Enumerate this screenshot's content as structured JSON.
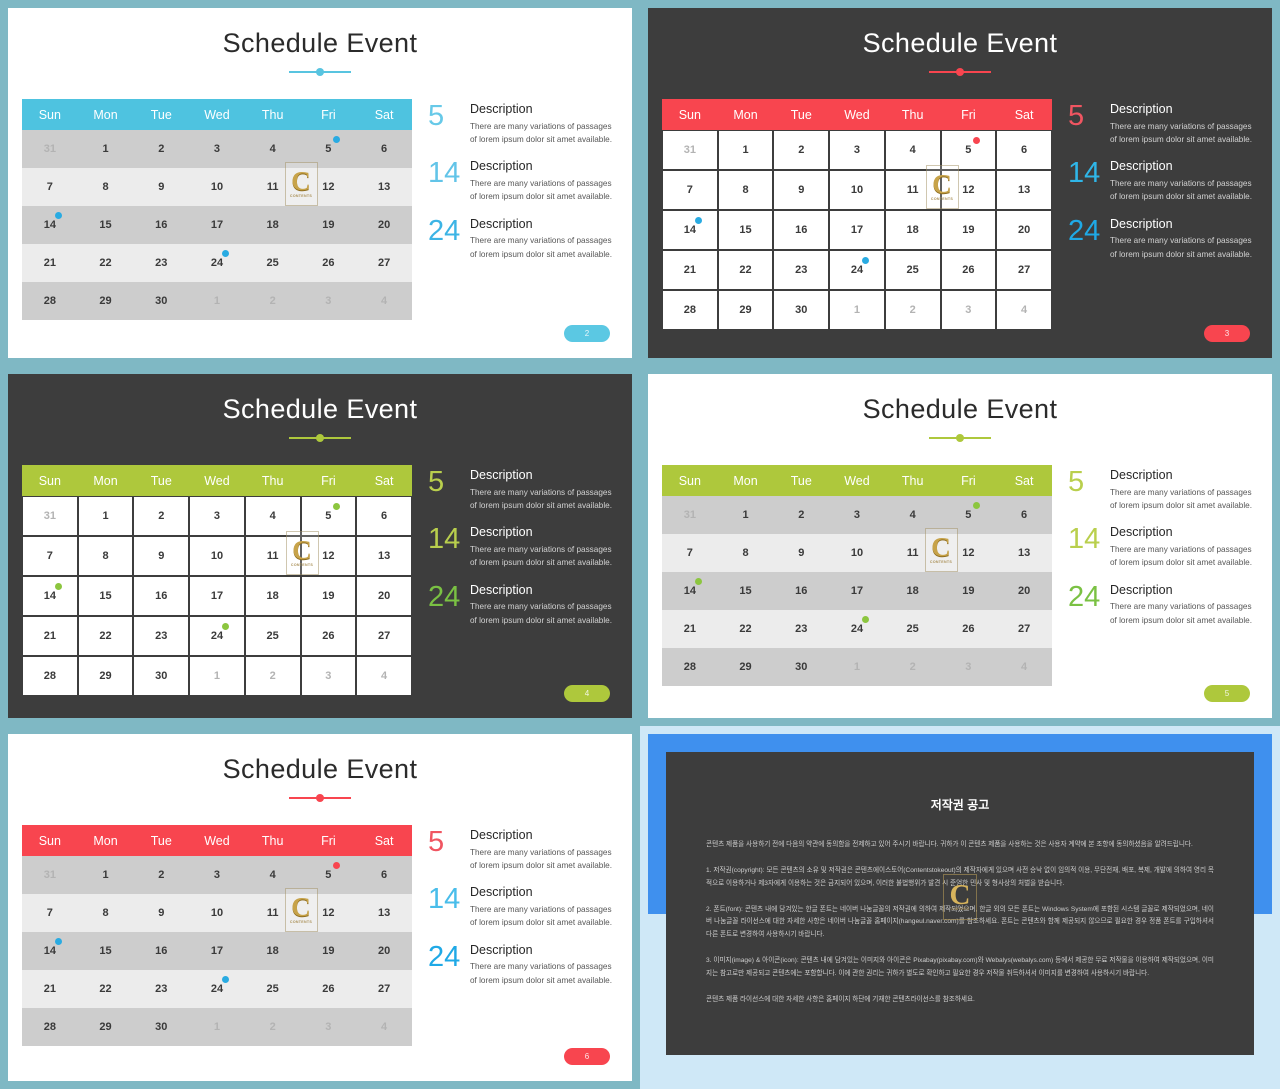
{
  "deck": {
    "frame_color": "#7fb8c4",
    "slide_title": "Schedule Event",
    "weekdays": [
      "Sun",
      "Mon",
      "Tue",
      "Wed",
      "Thu",
      "Fri",
      "Sat"
    ],
    "calendar_rows": [
      [
        {
          "d": "31",
          "muted": true
        },
        {
          "d": "1"
        },
        {
          "d": "2"
        },
        {
          "d": "3"
        },
        {
          "d": "4"
        },
        {
          "d": "5",
          "marker": true
        },
        {
          "d": "6"
        }
      ],
      [
        {
          "d": "7"
        },
        {
          "d": "8"
        },
        {
          "d": "9"
        },
        {
          "d": "10"
        },
        {
          "d": "11"
        },
        {
          "d": "12"
        },
        {
          "d": "13"
        }
      ],
      [
        {
          "d": "14",
          "marker": true
        },
        {
          "d": "15"
        },
        {
          "d": "16"
        },
        {
          "d": "17"
        },
        {
          "d": "18"
        },
        {
          "d": "19"
        },
        {
          "d": "20"
        }
      ],
      [
        {
          "d": "21"
        },
        {
          "d": "22"
        },
        {
          "d": "23"
        },
        {
          "d": "24",
          "marker": true
        },
        {
          "d": "25"
        },
        {
          "d": "26"
        },
        {
          "d": "27"
        }
      ],
      [
        {
          "d": "28"
        },
        {
          "d": "29"
        },
        {
          "d": "30"
        },
        {
          "d": "1",
          "muted": true
        },
        {
          "d": "2",
          "muted": true
        },
        {
          "d": "3",
          "muted": true
        },
        {
          "d": "4",
          "muted": true
        }
      ]
    ],
    "descriptions": [
      {
        "number": "5",
        "heading": "Description",
        "body": "There are many variations of passages of lorem ipsum dolor sit amet available."
      },
      {
        "number": "14",
        "heading": "Description",
        "body": "There are many variations of passages of lorem ipsum dolor sit amet available."
      },
      {
        "number": "24",
        "heading": "Description",
        "body": "There are many variations of passages of lorem ipsum dolor sit amet available."
      }
    ],
    "watermark": {
      "letter": "C",
      "sub": "CONTENTS"
    }
  },
  "slides": [
    {
      "id": "slide-2",
      "theme": "light",
      "page_number": "2",
      "accent": "#4ec3e0",
      "header_bg": "#4ec3e0",
      "marker_color": "#29abe2",
      "badge_bg": "#5bc8e3",
      "divider_color": "#58c4e0",
      "number_colors": [
        "#67c9e8",
        "#62c4e8",
        "#3cb4e5"
      ],
      "cell_style": "striped"
    },
    {
      "id": "slide-3",
      "theme": "dark",
      "page_number": "3",
      "accent": "#f8454f",
      "header_bg": "#f8454f",
      "marker_colors": [
        "#f8454f",
        "#29abe2",
        "#29abe2"
      ],
      "badge_bg": "#f8454f",
      "divider_color": "#f8454f",
      "number_colors": [
        "#f05561",
        "#2fb6e8",
        "#1fa9e6"
      ],
      "cell_style": "plainwhite"
    },
    {
      "id": "slide-4",
      "theme": "dark",
      "page_number": "4",
      "accent": "#aec83c",
      "header_bg": "#aec83c",
      "marker_color": "#8cc63f",
      "badge_bg": "#aec83c",
      "divider_color": "#aec83c",
      "number_colors": [
        "#b9cf4d",
        "#b9cf4d",
        "#7ac143"
      ],
      "cell_style": "plainwhite"
    },
    {
      "id": "slide-5",
      "theme": "light",
      "page_number": "5",
      "accent": "#aec83c",
      "header_bg": "#aec83c",
      "marker_color": "#8cc63f",
      "badge_bg": "#aec83c",
      "divider_color": "#aec83c",
      "number_colors": [
        "#b9cf4d",
        "#b9cf4d",
        "#7ac143"
      ],
      "cell_style": "striped"
    },
    {
      "id": "slide-6",
      "theme": "light",
      "page_number": "6",
      "accent": "#f8454f",
      "header_bg": "#f8454f",
      "marker_colors": [
        "#f8454f",
        "#29abe2",
        "#29abe2"
      ],
      "badge_bg": "#f8454f",
      "divider_color": "#f8454f",
      "number_colors": [
        "#f05561",
        "#49bdea",
        "#1fa9e6"
      ],
      "cell_style": "striped"
    }
  ],
  "copyright": {
    "border_top_color": "#3f90ee",
    "border_bottom_color": "#cfe8f7",
    "title": "저작권 공고",
    "paragraphs": [
      "콘텐츠 제품을 사용하기 전에 다음의 약관에 동의함을 전제하고 있어 주시기 바랍니다. 귀하가 이 콘텐츠 제품을 사용하는 것은 사용자 계약에 본 조항에 동의하셨음을 알려드립니다.",
      "1. 저작권(copyright): 모든 콘텐츠의 소유 및 저작권은 콘텐츠에이스토어(Contentstokeout)의 제작자에게 있으며 사전 승낙 없이 임의적 이용, 무단전재, 배포, 복제, 개발에 의하여 영리 목적으로 이용하거나 제3자에게 이용하는 것은 금지되어 있으며, 이러한 불법행위가 발견 시 준엄한 민사 및 형사상의 처벌을 받습니다.",
      "2. 폰트(font): 콘텐츠 내에 담겨있는 한글 폰트는 네이버 나눔글꼴의 저작권에 의하여 제작되었으며, 한글 외의 모든 폰트는 Windows System에 포함된 시스템 글꼴로 제작되었으며, 네이버 나눔글꼴 라이선스에 대한 자세한 사항은 네이버 나눔글꼴 홈페이지(hangeul.naver.com)를 참조하세요. 폰트는 콘텐츠와 함께 제공되지 않으므로 필요한 경우 정품 폰트를 구입하셔서 다른 폰트로 변경하여 사용하시기 바랍니다.",
      "3. 이미지(image) & 아이콘(icon): 콘텐츠 내에 담겨있는 이미지와 아이콘은 Pixabay(pixabay.com)와 Webalys(webalys.com) 등에서 제공한 무료 저작물을 이용하여 제작되었으며, 이미지는 참고로만 제공되고 콘텐츠에는 포함합니다. 이에 관한 권리는 귀하가 별도로 확인하고 필요한 경우 저작물 취득하셔서 이미지를 변경하여 사용하시기 바랍니다.",
      "콘텐츠 제품 라이선스에 대한 자세한 사항은 홈페이지 하단에 기재한 콘텐츠라이선스를 참조하세요."
    ],
    "watermark": {
      "letter": "C",
      "sub": "CONTENTS"
    }
  }
}
